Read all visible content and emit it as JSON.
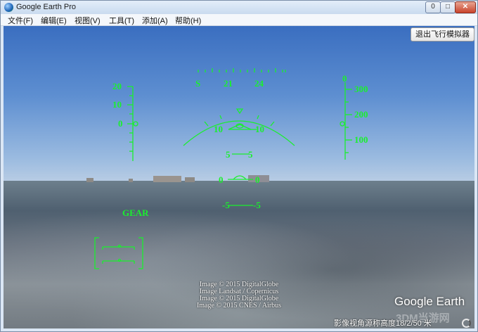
{
  "window": {
    "title": "Google Earth Pro",
    "minimize": "0",
    "maximize": "□",
    "close": "r"
  },
  "menu": [
    "文件(F)",
    "编辑(E)",
    "视图(V)",
    "工具(T)",
    "添加(A)",
    "帮助(H)"
  ],
  "exit_flight_simulator": "退出飞行模拟器",
  "hud": {
    "heading_labels": [
      "S",
      "21",
      "24"
    ],
    "speed_labels": [
      "20",
      "10",
      "0"
    ],
    "altitude_labels": [
      "0",
      "300",
      "200",
      "100"
    ],
    "pitch_labels": [
      "10",
      "10",
      "5",
      "5",
      "0",
      "0",
      "-5",
      "-5"
    ],
    "gear": "GEAR"
  },
  "credits": [
    "Image © 2015 DigitalGlobe",
    "Image Landsat / Copernicus",
    "Image © 2015 DigitalGlobe",
    "Image © 2015 CNES / Airbus"
  ],
  "logo": "Google Earth",
  "watermark": "3DM当游网",
  "status": "影像视角源称高度18/2/50 米",
  "colors": {
    "hud": "#1aef2e",
    "sky_top": "#3a6ec0",
    "title_bar": "#c9dbef"
  }
}
